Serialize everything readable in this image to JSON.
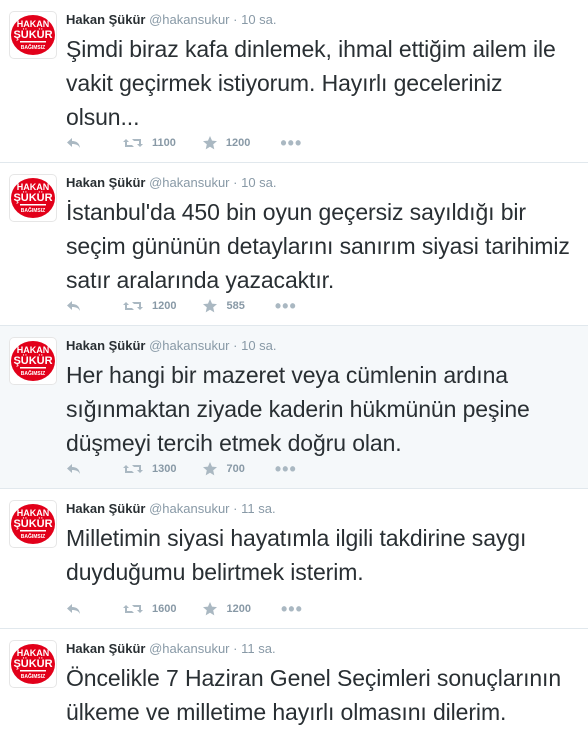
{
  "colors": {
    "name": "#292f33",
    "meta": "#8899a6",
    "icons": "#aab8c2",
    "avatar_red": "#e2001a",
    "highlight_bg": "#f5f8fa"
  },
  "avatar": {
    "line1": "HAKAN",
    "line2": "ŞÜKÜR",
    "line3": "BAĞIMSIZ"
  },
  "tweets": [
    {
      "name": "Hakan Şükür",
      "handle": "@hakansukur",
      "dot": "·",
      "time": "10 sa.",
      "text": "Şimdi biraz kafa dinlemek, ihmal ettiğim ailem ile vakit geçirmek istiyorum. Hayırlı geceleriniz olsun...",
      "retweets": "1100",
      "favorites": "1200",
      "more": "•••"
    },
    {
      "name": "Hakan Şükür",
      "handle": "@hakansukur",
      "dot": "·",
      "time": "10 sa.",
      "text": "İstanbul'da 450 bin oyun geçersiz sayıldığı bir seçim gününün detaylarını sanırım siyasi tarihimiz satır aralarında yazacaktır.",
      "retweets": "1200",
      "favorites": "585",
      "more": "•••"
    },
    {
      "name": "Hakan Şükür",
      "handle": "@hakansukur",
      "dot": "·",
      "time": "10 sa.",
      "text": "Her hangi bir mazeret veya cümlenin ardına sığınmaktan ziyade kaderin hükmünün peşine düşmeyi tercih etmek doğru olan.",
      "retweets": "1300",
      "favorites": "700",
      "more": "•••"
    },
    {
      "name": "Hakan Şükür",
      "handle": "@hakansukur",
      "dot": "·",
      "time": "11 sa.",
      "text": "Milletimin siyasi hayatımla ilgili takdirine saygı duyduğumu belirtmek isterim.",
      "retweets": "1600",
      "favorites": "1200",
      "more": "•••"
    },
    {
      "name": "Hakan Şükür",
      "handle": "@hakansukur",
      "dot": "·",
      "time": "11 sa.",
      "text": "Öncelikle 7 Haziran Genel Seçimleri sonuçlarının ülkeme ve milletime hayırlı olmasını dilerim."
    }
  ]
}
